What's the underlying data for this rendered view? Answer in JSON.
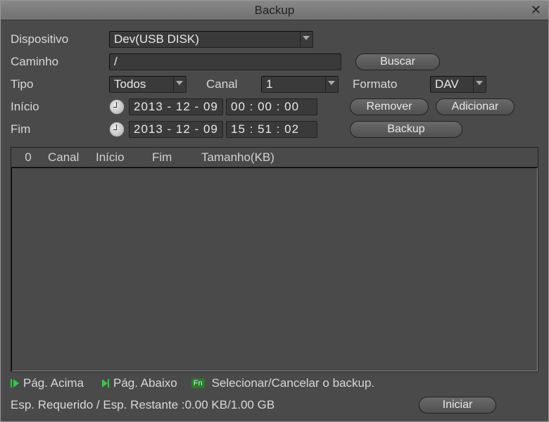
{
  "window": {
    "title": "Backup"
  },
  "labels": {
    "device": "Dispositivo",
    "path": "Caminho",
    "type": "Tipo",
    "channel": "Canal",
    "format": "Formato",
    "start": "Início",
    "end": "Fim"
  },
  "values": {
    "device": "Dev(USB DISK)",
    "path": "/",
    "type": "Todos",
    "channel": "1",
    "format": "DAV",
    "start_date": "2013 - 12 - 09",
    "start_time": "00 : 00 : 00",
    "end_date": "2013 - 12 - 09",
    "end_time": "15 : 51 : 02"
  },
  "buttons": {
    "search": "Buscar",
    "remove": "Remover",
    "add": "Adicionar",
    "backup": "Backup",
    "start": "Iniciar"
  },
  "table": {
    "count": "0",
    "headers": {
      "channel": "Canal",
      "start": "Início",
      "end": "Fim",
      "size": "Tamanho(KB)"
    }
  },
  "footer": {
    "page_up": "Pág. Acima",
    "page_down": "Pág. Abaixo",
    "fn": "Fn",
    "select_cancel": "Selecionar/Cancelar o backup.",
    "space": "Esp. Requerido / Esp. Restante :0.00 KB/1.00 GB"
  }
}
